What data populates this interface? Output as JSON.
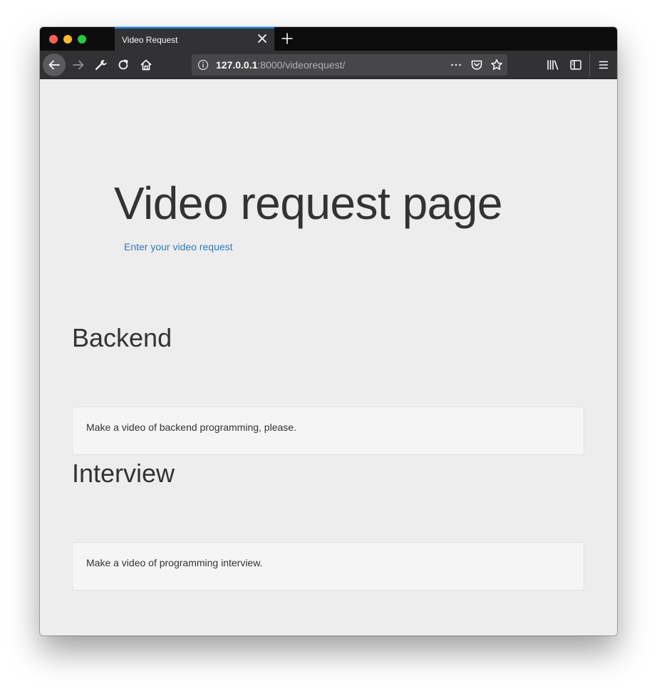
{
  "browser": {
    "tab_title": "Video Request",
    "url_host": "127.0.0.1",
    "url_rest": ":8000/videorequest/"
  },
  "page": {
    "title": "Video request page",
    "request_link": "Enter your video request",
    "sections": [
      {
        "heading": "Backend",
        "description": "Make a video of backend programming, please."
      },
      {
        "heading": "Interview",
        "description": "Make a video of programming interview."
      }
    ]
  },
  "icons": {
    "back": "arrow-left-icon",
    "forward": "arrow-right-icon",
    "tools": "wrench-icon",
    "reload": "reload-icon",
    "home": "home-icon",
    "info": "info-icon",
    "more": "ellipsis-icon",
    "pocket": "pocket-icon",
    "bookmark": "star-icon",
    "library": "library-icon",
    "sidebar": "sidebar-icon",
    "menu": "hamburger-menu-icon"
  },
  "colors": {
    "tab_accent": "#0a84ff",
    "link": "#337ab7",
    "page_background": "#ededed"
  }
}
